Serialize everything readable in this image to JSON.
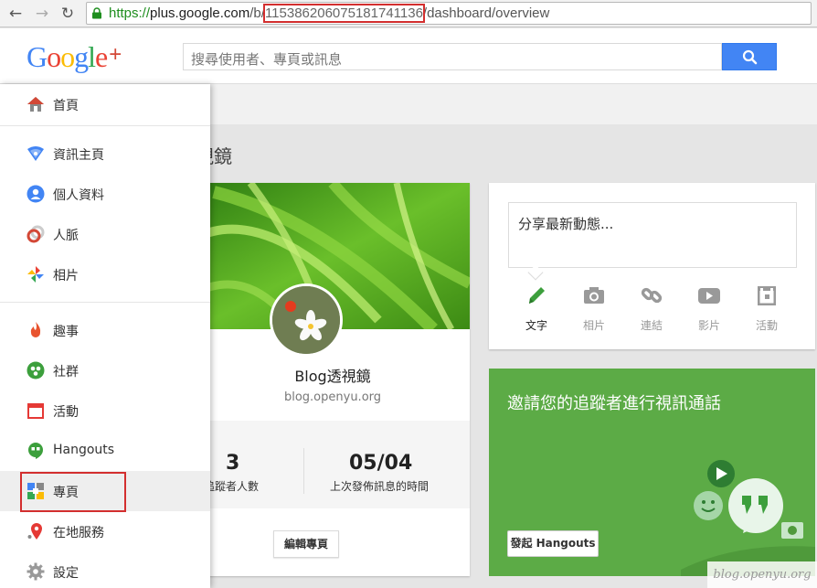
{
  "browser": {
    "back": "←",
    "forward": "→",
    "reload": "↻",
    "url_scheme": "https://",
    "url_host": "plus.google.com",
    "url_path_prefix": "/b/",
    "url_page_id": "115386206075181741136",
    "url_path_suffix": "/dashboard/overview"
  },
  "header": {
    "logo_letters": [
      "G",
      "o",
      "o",
      "g",
      "l",
      "e"
    ],
    "logo_colors": [
      "#4285f4",
      "#ea4335",
      "#fbbc05",
      "#4285f4",
      "#34a853",
      "#ea4335"
    ],
    "logo_plus": "+",
    "search_placeholder": "搜尋使用者、專頁或訊息"
  },
  "page": {
    "title": "視鏡"
  },
  "profile": {
    "name": "Blog透視鏡",
    "site": "blog.openyu.org",
    "followers_count": "3",
    "followers_label": "追蹤者人數",
    "last_post_date": "05/04",
    "last_post_label": "上次發佈訊息的時間",
    "edit_button": "編輯專頁"
  },
  "share": {
    "prompt": "分享最新動態...",
    "items": [
      {
        "label": "文字",
        "icon": "pencil-icon"
      },
      {
        "label": "相片",
        "icon": "camera-icon"
      },
      {
        "label": "連結",
        "icon": "link-icon"
      },
      {
        "label": "影片",
        "icon": "video-icon"
      },
      {
        "label": "活動",
        "icon": "event-icon"
      }
    ]
  },
  "hangouts": {
    "title": "邀請您的追蹤者進行視訊通話",
    "button": "發起 Hangouts"
  },
  "drawer": {
    "items": [
      {
        "label": "首頁",
        "icon": "home-icon"
      },
      {
        "label": "資訊主頁",
        "icon": "news-icon"
      },
      {
        "label": "個人資料",
        "icon": "profile-icon"
      },
      {
        "label": "人脈",
        "icon": "people-icon"
      },
      {
        "label": "相片",
        "icon": "photos-icon"
      },
      {
        "label": "趣事",
        "icon": "whats-hot-icon"
      },
      {
        "label": "社群",
        "icon": "communities-icon"
      },
      {
        "label": "活動",
        "icon": "events-icon"
      },
      {
        "label": "Hangouts",
        "icon": "hangouts-icon"
      },
      {
        "label": "專頁",
        "icon": "pages-icon"
      },
      {
        "label": "在地服務",
        "icon": "local-icon"
      },
      {
        "label": "設定",
        "icon": "settings-icon"
      }
    ]
  },
  "watermark": "blog.openyu.org",
  "colors": {
    "accent_blue": "#4285f4",
    "hangouts_green": "#5cab46",
    "highlight_red": "#d32f2f"
  }
}
